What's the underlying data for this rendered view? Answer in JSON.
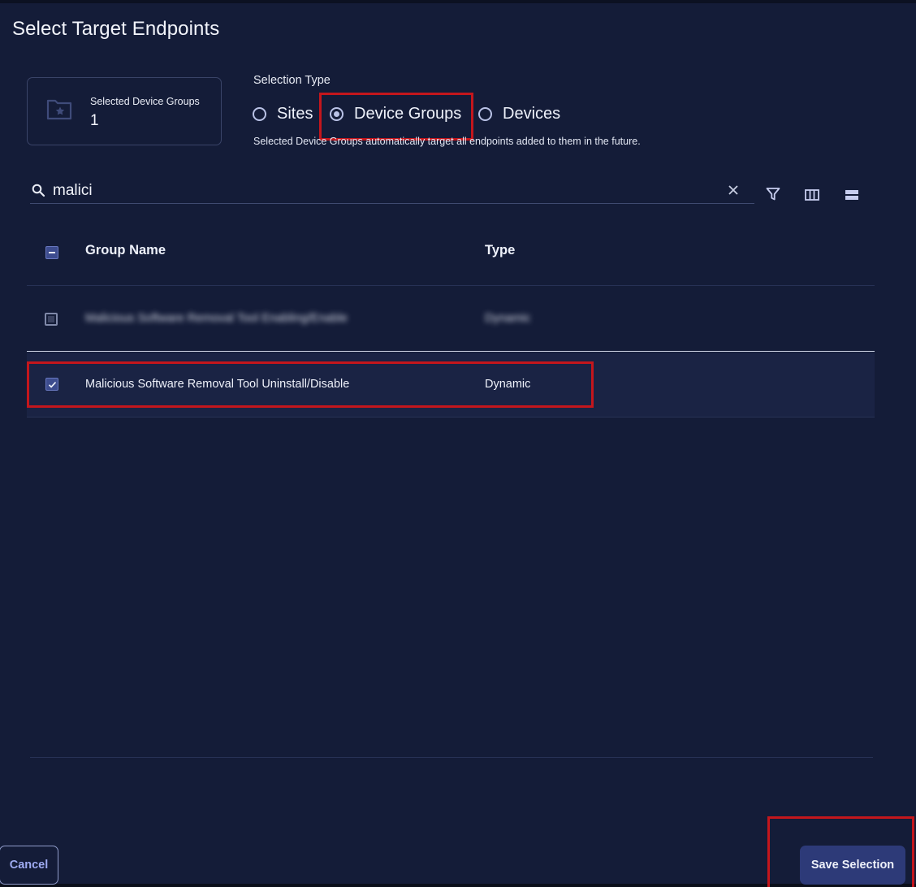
{
  "dialog": {
    "title": "Select Target Endpoints"
  },
  "summary": {
    "label": "Selected Device Groups",
    "count": "1",
    "icon": "folder-star-icon"
  },
  "selection_type": {
    "label": "Selection Type",
    "options": [
      {
        "label": "Sites",
        "selected": false
      },
      {
        "label": "Device Groups",
        "selected": true
      },
      {
        "label": "Devices",
        "selected": false
      }
    ],
    "helper": "Selected Device Groups automatically target all endpoints added to them in the future."
  },
  "search": {
    "value": "malici",
    "icons": [
      "search-icon",
      "clear-icon"
    ]
  },
  "toolbar": {
    "icons": [
      "filter-icon",
      "columns-icon",
      "density-icon"
    ]
  },
  "table": {
    "columns": [
      "Group Name",
      "Type"
    ],
    "rows": [
      {
        "name": "Malicious Software Removal Tool Enabling/Enable",
        "type": "Dynamic",
        "checked": false,
        "blurred": true
      },
      {
        "name": "Malicious Software Removal Tool Uninstall/Disable",
        "type": "Dynamic",
        "checked": true,
        "blurred": false
      }
    ]
  },
  "footer": {
    "cancel_label": "Cancel",
    "save_label": "Save Selection"
  },
  "colors": {
    "background": "#141c38",
    "accent": "#2d3a78",
    "highlight": "#c4161c"
  }
}
